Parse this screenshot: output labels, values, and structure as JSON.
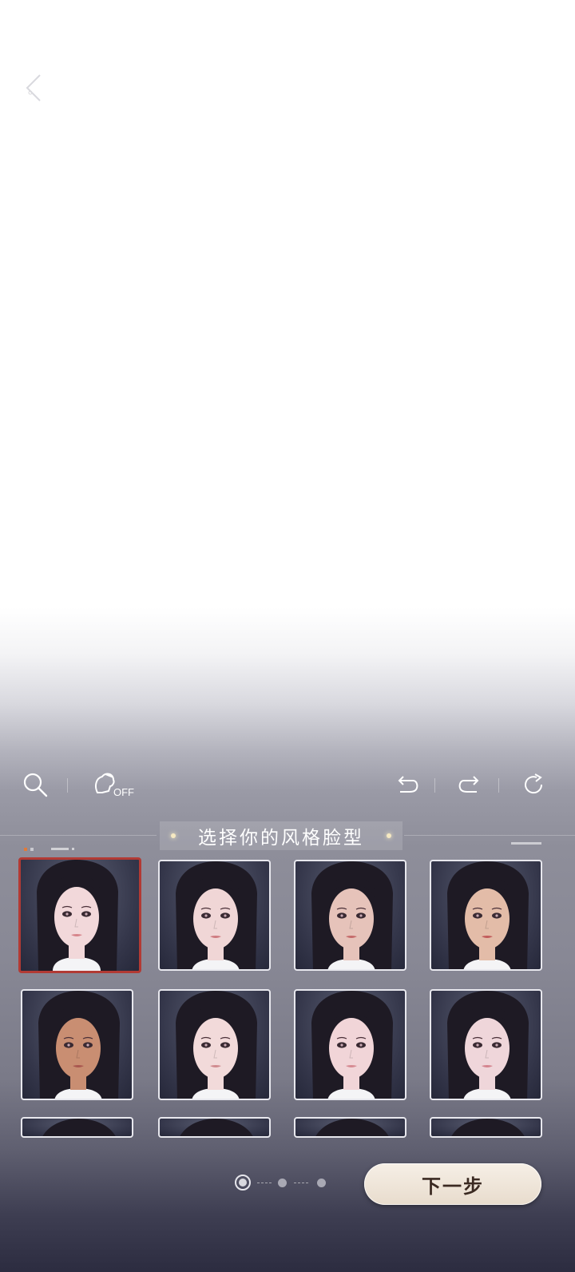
{
  "title": "选择你的风格脸型",
  "toolbar": {
    "hair_toggle_label": "OFF"
  },
  "next_button_label": "下一步",
  "pagination": {
    "pages": 3,
    "current": 1
  },
  "faces": [
    {
      "name": "face-1",
      "skin": "#f2d8da",
      "lip": "#d6848a",
      "selected": true
    },
    {
      "name": "face-2",
      "skin": "#f0d6d6",
      "lip": "#cf7b80",
      "selected": false
    },
    {
      "name": "face-3",
      "skin": "#e6c3ba",
      "lip": "#c56a6a",
      "selected": false
    },
    {
      "name": "face-4",
      "skin": "#e3bca8",
      "lip": "#c25b5b",
      "selected": false
    },
    {
      "name": "face-5",
      "skin": "#c98e72",
      "lip": "#a9574f",
      "selected": false
    },
    {
      "name": "face-6",
      "skin": "#f2dada",
      "lip": "#d08a8e",
      "selected": false
    },
    {
      "name": "face-7",
      "skin": "#f1d5d8",
      "lip": "#d68a92",
      "selected": false
    },
    {
      "name": "face-8",
      "skin": "#efd6da",
      "lip": "#d4848e",
      "selected": false
    },
    {
      "name": "face-9",
      "skin": "#e8cfd0",
      "lip": "#cc8087",
      "selected": false
    },
    {
      "name": "face-10",
      "skin": "#e8cfd0",
      "lip": "#cc8087",
      "selected": false
    },
    {
      "name": "face-11",
      "skin": "#e8cfd0",
      "lip": "#cc8087",
      "selected": false
    },
    {
      "name": "face-12",
      "skin": "#e8cfd0",
      "lip": "#cc8087",
      "selected": false
    }
  ],
  "colors": {
    "selected_border": "#b23a34",
    "hair": "#1e1a24"
  }
}
